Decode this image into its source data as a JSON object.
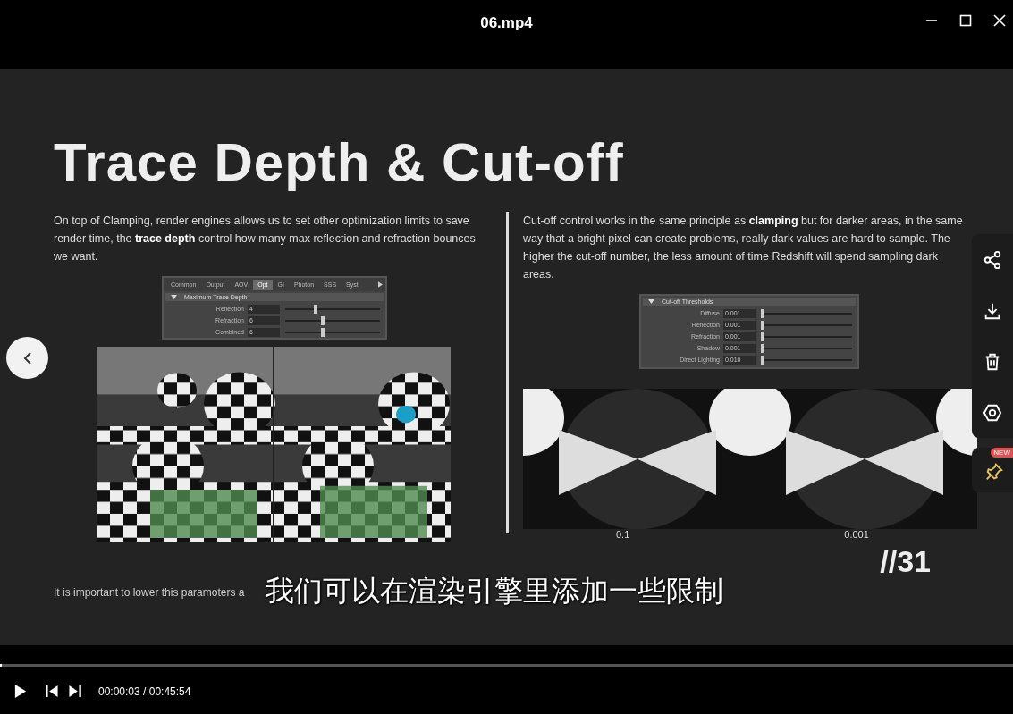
{
  "window": {
    "title": "06.mp4"
  },
  "slide": {
    "title": "Trace Depth & Cut-off",
    "left": {
      "paragraph": "On top of Clamping, render engines allows us to set other optimization limits to save render time, the **trace depth** control how many max reflection and refraction bounces we want.",
      "panel": {
        "tabs": [
          {
            "label": "Common",
            "selected": false
          },
          {
            "label": "Output",
            "selected": false
          },
          {
            "label": "AOV",
            "selected": false
          },
          {
            "label": "Opt",
            "selected": true
          },
          {
            "label": "GI",
            "selected": false
          },
          {
            "label": "Photon",
            "selected": false
          },
          {
            "label": "SSS",
            "selected": false
          },
          {
            "label": "Syst",
            "selected": false
          }
        ],
        "section": "Maximum Trace Depth",
        "rows": [
          {
            "label": "Reflection",
            "value": "4",
            "level": 0.3
          },
          {
            "label": "Refraction",
            "value": "6",
            "level": 0.38
          },
          {
            "label": "Combined",
            "value": "6",
            "level": 0.38
          }
        ]
      },
      "note": "It is important to lower this paramoters a"
    },
    "right": {
      "paragraph": "Cut-off control works in the same principle as **clamping** but for darker areas, in the same way that a bright pixel can create problems, really dark values are hard to sample. The higher the cut-off number, the less amount of time Redshift will spend sampling dark areas.",
      "panel": {
        "section": "Cut-off Thresholds",
        "rows": [
          {
            "label": "Diffuse",
            "value": "0.001",
            "level": 0.0
          },
          {
            "label": "Reflection",
            "value": "0.001",
            "level": 0.0
          },
          {
            "label": "Refraction",
            "value": "0.001",
            "level": 0.0
          },
          {
            "label": "Shadow",
            "value": "0.001",
            "level": 0.0
          },
          {
            "label": "Direct Lighting",
            "value": "0.010",
            "level": 0.0
          }
        ]
      },
      "captions": [
        "0.1",
        "0.001"
      ]
    },
    "page_number": "//31"
  },
  "subtitle": "我们可以在渲染引擎里添加一些限制",
  "side_toolbar": {
    "pin_badge": "NEW"
  },
  "player": {
    "progress": {
      "level": 0.002
    },
    "time": "00:00:03 / 00:45:54"
  }
}
